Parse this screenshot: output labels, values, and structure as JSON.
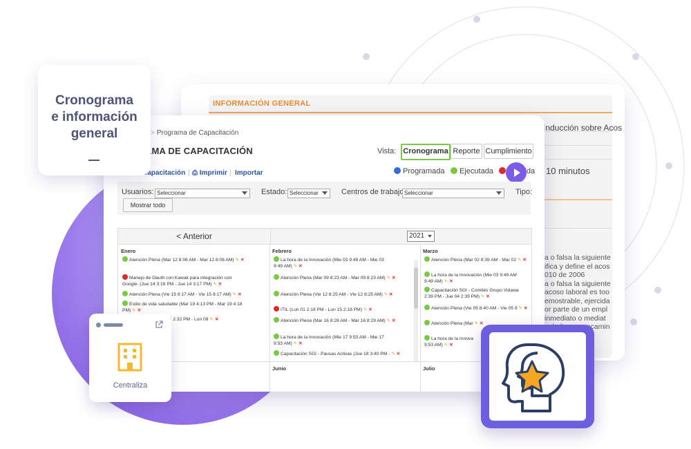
{
  "back_panel": {
    "header": "INFORMACIÓN GENERAL",
    "row1": "Inducción sobre Acos",
    "row2": "10 minutos",
    "paragraph": [
      "a o falsa la siguiente",
      "ifica y define el acos",
      "010 de 2006",
      "a o falsa la siguiente",
      "acoso laboral es too",
      "emostrable, ejercida",
      "or parte de un empl",
      "inmediato o mediat",
      "subalterno, encamin",
      "usar pe",
      "abajo"
    ]
  },
  "front_panel": {
    "breadcrumb": [
      "mano",
      "Programa de Capacitación"
    ],
    "title": "GRAMA DE CAPACITACIÓN",
    "vista_label": "Vista:",
    "view_buttons": [
      "Cronograma",
      "Reporte",
      "Cumplimiento"
    ],
    "toolbar": [
      "Capacitación",
      "Imprimir",
      "Importar"
    ],
    "legend": [
      {
        "label": "Programada",
        "color": "#2f6fd6"
      },
      {
        "label": "Ejecutada",
        "color": "#7ac943"
      },
      {
        "label": "Vencida",
        "color": "#d92b2b"
      }
    ],
    "filters": {
      "usuarios_label": "Usuarios:",
      "usuarios_value": "Seleccionar",
      "estado_label": "Estado:",
      "estado_value": "Seleccionar",
      "centros_label": "Centros de trabajo:",
      "centros_value": "Seleccionar",
      "tipo_label": "Tipo:",
      "mostrar_todo": "Mostrar todo"
    },
    "calendar": {
      "prev": "< Anterior",
      "year": "2021",
      "months": [
        {
          "name": "Enero",
          "events": [
            {
              "color": "green",
              "lines": [
                "Atención Plena (Mar 12 8:06 AM - Mar 12 8:06 AM)"
              ]
            },
            {
              "color": "red",
              "lines": [
                "Manejo de Oauth con Kawak para integración con",
                "Google. (Jue 14 3:16 PM - Jue 14 3:17 PM)"
              ]
            },
            {
              "color": "green",
              "lines": [
                "Atención Plena (Vie 15 8:17 AM - Vie 15 8:17 AM)"
              ]
            },
            {
              "color": "green",
              "lines": [
                "Estilo de vida saludable (Mar 19 4:13 PM - Mar 19 4:18",
                "PM)"
              ]
            },
            {
              "color": "green",
              "lines": [
                "de software) (Lun 25 2:32 PM - Lun 08"
              ]
            }
          ]
        },
        {
          "name": "Febrero",
          "events": [
            {
              "color": "green",
              "lines": [
                "La hora de la Innovación (Mie 03 9:49 AM - Mie 03",
                "9:49 AM)"
              ]
            },
            {
              "color": "green",
              "lines": [
                "Atención Plena (Mar 09 8:23 AM - Mar 09 8:23 AM)"
              ]
            },
            {
              "color": "green",
              "lines": [
                "Atención Plena (Vie 12 8:25 AM - Vie 12 8:25 AM)"
              ]
            },
            {
              "color": "red",
              "lines": [
                "ITIL (Lun 01 2:18 PM - Lun 15 2:18 PM)"
              ]
            },
            {
              "color": "green",
              "lines": [
                "Atención Plena (Mar 16 8:28 AM - Mar 16 8:29 AM)"
              ]
            },
            {
              "color": "green",
              "lines": [
                "La hora de la Innovación (Mie 17 9:53 AM - Mie 17",
                "9:53 AM)"
              ]
            },
            {
              "color": "green",
              "lines": [
                "Capacitación SGI - Pausas Activas (Jue 18 3:40 PM -"
              ]
            }
          ]
        },
        {
          "name": "Marzo",
          "events": [
            {
              "color": "green",
              "lines": [
                "Atención Plena (Mar 02 8:39 AM - Mar 02"
              ]
            },
            {
              "color": "green",
              "lines": [
                "La hora de la Innovación (Mie 03 9:49 AM",
                "9:49 AM)"
              ]
            },
            {
              "color": "green",
              "lines": [
                "Capacitación SGI - Comités Grupo Vidawa",
                "2:39 PM - Jue 04 2:39 PM)"
              ]
            },
            {
              "color": "green",
              "lines": [
                "Atención Plena (Vie 05 8:40 AM - Vie 05 8"
              ]
            },
            {
              "color": "green",
              "lines": [
                "Atención Plena (Mar"
              ]
            },
            {
              "color": "green",
              "lines": [
                "La hora de la Innova",
                "9:53 AM)"
              ]
            }
          ]
        }
      ],
      "row2_months": [
        "Junio",
        "Julio"
      ]
    }
  },
  "label_card": {
    "text": "Cronograma\ne información\ngeneral"
  },
  "cent_card": {
    "label": "Centraliza",
    "icon": "building-icon",
    "accent": "#f5b82e"
  },
  "icon_card": {
    "icon": "head-star-icon",
    "accent": "#f5a623",
    "frame": "#6d5ee0"
  }
}
